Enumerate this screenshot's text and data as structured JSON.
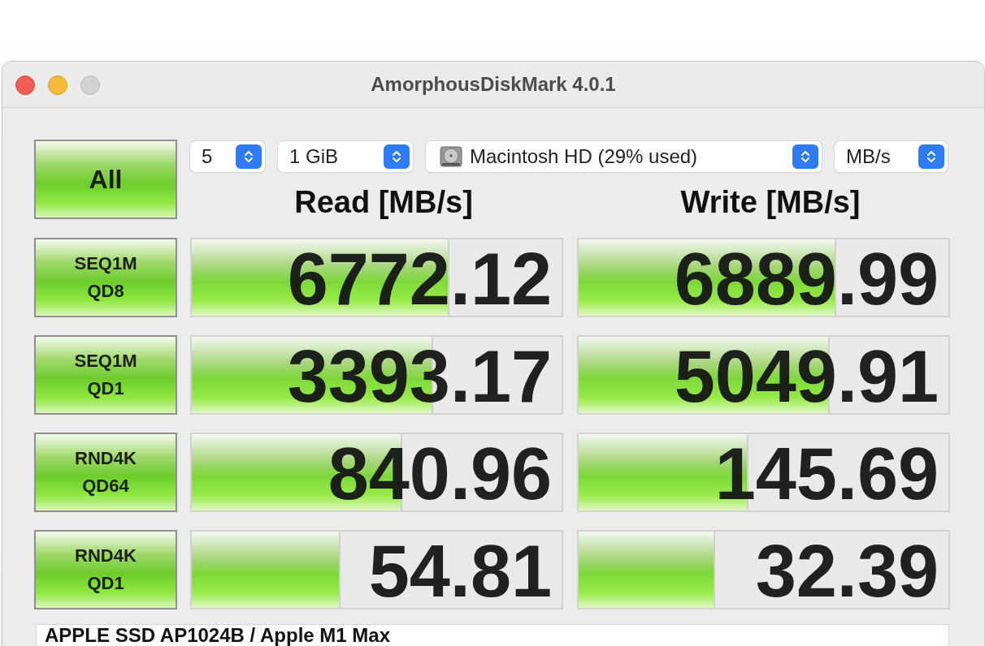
{
  "window": {
    "title": "AmorphousDiskMark 4.0.1"
  },
  "all_button": {
    "label": "All"
  },
  "selectors": [
    {
      "kind": "plain",
      "value": "5"
    },
    {
      "kind": "plain",
      "value": "1 GiB"
    },
    {
      "kind": "disk",
      "value": "Macintosh HD (29% used)"
    },
    {
      "kind": "plain",
      "value": "MB/s"
    }
  ],
  "headers": [
    "Read [MB/s]",
    "Write [MB/s]"
  ],
  "tests": [
    {
      "label": "SEQ1M\nQD8",
      "read": {
        "value": "6772.12",
        "level": 0.693
      },
      "write": {
        "value": "6889.99",
        "level": 0.693
      }
    },
    {
      "label": "SEQ1M\nQD1",
      "read": {
        "value": "3393.17",
        "level": 0.649
      },
      "write": {
        "value": "5049.91",
        "level": 0.675
      }
    },
    {
      "label": "RND4K\nQD64",
      "read": {
        "value": "840.96",
        "level": 0.564
      },
      "write": {
        "value": "145.69",
        "level": 0.455
      }
    },
    {
      "label": "RND4K\nQD1",
      "read": {
        "value": "54.81",
        "level": 0.397
      },
      "write": {
        "value": "32.39",
        "level": 0.364
      }
    }
  ],
  "comment_field": {
    "value": "APPLE SSD AP1024B / Apple M1 Max"
  }
}
